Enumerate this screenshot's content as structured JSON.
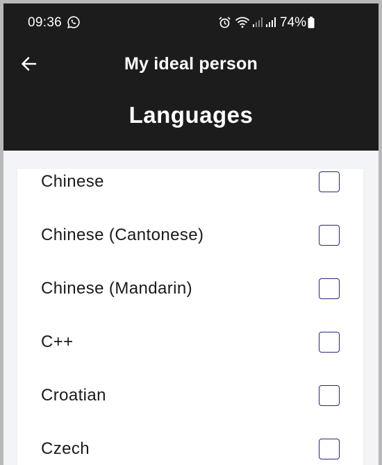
{
  "status_bar": {
    "time": "09:36",
    "battery": "74%",
    "icons": [
      "whatsapp-icon",
      "alarm-icon",
      "wifi-icon",
      "signal-icon",
      "signal-icon",
      "battery-icon"
    ]
  },
  "header": {
    "back_icon": "arrow-left-icon",
    "title": "My ideal person",
    "subtitle": "Languages",
    "background": "#1c1c1c"
  },
  "languages": [
    {
      "label": "Chinese",
      "checked": false
    },
    {
      "label": "Chinese (Cantonese)",
      "checked": false
    },
    {
      "label": "Chinese (Mandarin)",
      "checked": false
    },
    {
      "label": "C++",
      "checked": false
    },
    {
      "label": "Croatian",
      "checked": false
    },
    {
      "label": "Czech",
      "checked": false
    }
  ],
  "colors": {
    "checkbox_border": "#26267a",
    "list_background": "#f2f4f8"
  }
}
